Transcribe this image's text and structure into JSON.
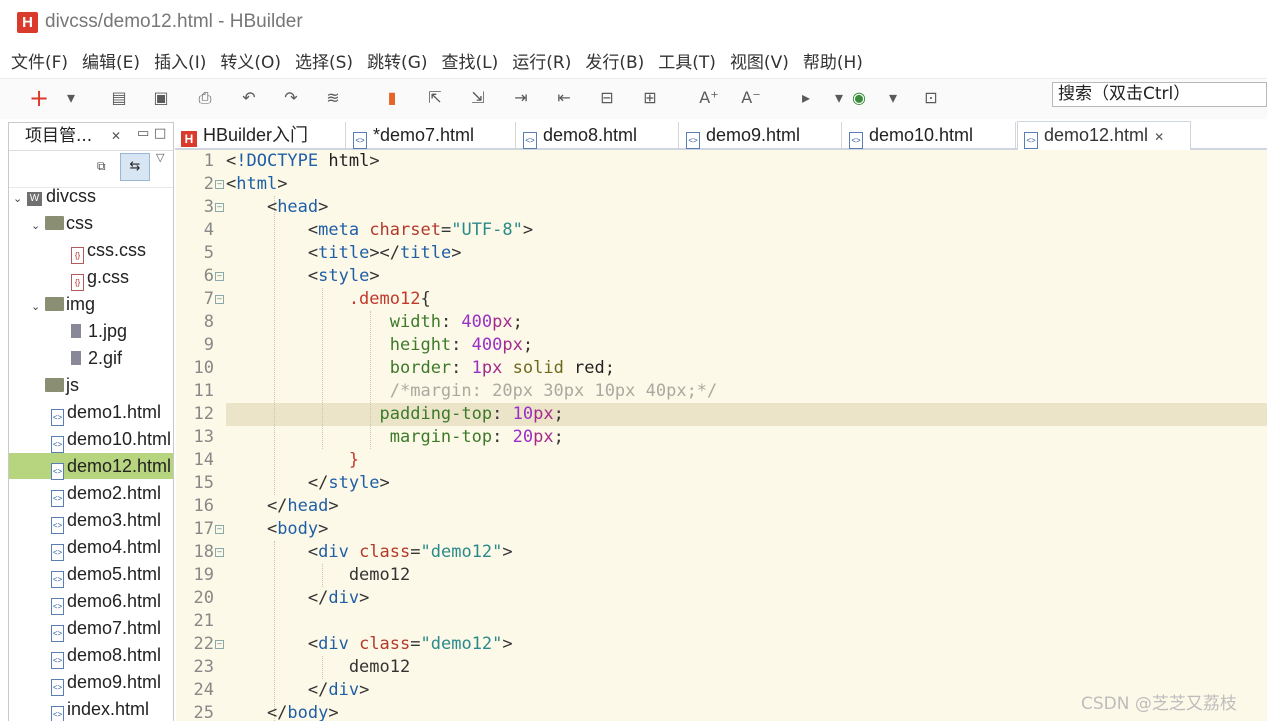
{
  "window": {
    "title": "divcss/demo12.html  -  HBuilder",
    "logo": "H"
  },
  "menu": [
    "文件(F)",
    "编辑(E)",
    "插入(I)",
    "转义(O)",
    "选择(S)",
    "跳转(G)",
    "查找(L)",
    "运行(R)",
    "发行(B)",
    "工具(T)",
    "视图(V)",
    "帮助(H)"
  ],
  "toolbar": {
    "search_placeholder": "搜索（双击Ctrl）",
    "icons": [
      "new-icon",
      "dropdown-icon",
      "save-icon",
      "save-all-icon",
      "print-icon",
      "undo-icon",
      "redo-icon",
      "format-icon",
      "bookmark-icon",
      "import-icon",
      "export-icon",
      "indent-icon",
      "outdent-icon",
      "comment-icon",
      "uncomment-icon",
      "font-increase-icon",
      "font-decrease-icon",
      "run-icon",
      "browser-chrome-icon",
      "preview-icon"
    ]
  },
  "project_panel": {
    "title": "项目管...",
    "tree": [
      {
        "label": "divcss",
        "type": "project",
        "depth": 0,
        "expanded": true
      },
      {
        "label": "css",
        "type": "folder",
        "depth": 1,
        "expanded": true
      },
      {
        "label": "css.css",
        "type": "css",
        "depth": 2
      },
      {
        "label": "g.css",
        "type": "css",
        "depth": 2
      },
      {
        "label": "img",
        "type": "folder",
        "depth": 1,
        "expanded": true
      },
      {
        "label": "1.jpg",
        "type": "file",
        "depth": 2
      },
      {
        "label": "2.gif",
        "type": "file",
        "depth": 2
      },
      {
        "label": "js",
        "type": "folder",
        "depth": 1
      },
      {
        "label": "demo1.html",
        "type": "html",
        "depth": 1
      },
      {
        "label": "demo10.html",
        "type": "html",
        "depth": 1
      },
      {
        "label": "demo12.html",
        "type": "html",
        "depth": 1,
        "selected": true
      },
      {
        "label": "demo2.html",
        "type": "html",
        "depth": 1
      },
      {
        "label": "demo3.html",
        "type": "html",
        "depth": 1
      },
      {
        "label": "demo4.html",
        "type": "html",
        "depth": 1
      },
      {
        "label": "demo5.html",
        "type": "html",
        "depth": 1
      },
      {
        "label": "demo6.html",
        "type": "html",
        "depth": 1
      },
      {
        "label": "demo7.html",
        "type": "html",
        "depth": 1
      },
      {
        "label": "demo8.html",
        "type": "html",
        "depth": 1
      },
      {
        "label": "demo9.html",
        "type": "html",
        "depth": 1
      },
      {
        "label": "index.html",
        "type": "html",
        "depth": 1
      }
    ]
  },
  "tabs": [
    {
      "label": "HBuilder入门",
      "icon": "hbuilder"
    },
    {
      "label": "*demo7.html",
      "icon": "html"
    },
    {
      "label": "demo8.html",
      "icon": "html"
    },
    {
      "label": "demo9.html",
      "icon": "html"
    },
    {
      "label": "demo10.html",
      "icon": "html"
    },
    {
      "label": "demo12.html",
      "icon": "html",
      "active": true
    }
  ],
  "editor": {
    "current_line": 12,
    "lines": [
      {
        "n": "1",
        "fold": false,
        "tokens": [
          [
            "punc",
            "<"
          ],
          [
            "tag",
            "!DOCTYPE"
          ],
          [
            "val",
            " html"
          ],
          [
            "punc",
            ">"
          ]
        ]
      },
      {
        "n": "2",
        "fold": true,
        "tokens": [
          [
            "punc",
            "<"
          ],
          [
            "tag",
            "html"
          ],
          [
            "punc",
            ">"
          ]
        ]
      },
      {
        "n": "3",
        "fold": true,
        "tokens": [
          [
            "punc",
            "    <"
          ],
          [
            "tag",
            "head"
          ],
          [
            "punc",
            ">"
          ]
        ]
      },
      {
        "n": "4",
        "fold": false,
        "tokens": [
          [
            "punc",
            "        <"
          ],
          [
            "tag",
            "meta"
          ],
          [
            "attr",
            " charset"
          ],
          [
            "punc",
            "="
          ],
          [
            "str",
            "\"UTF-8\""
          ],
          [
            "punc",
            ">"
          ]
        ]
      },
      {
        "n": "5",
        "fold": false,
        "tokens": [
          [
            "punc",
            "        <"
          ],
          [
            "tag",
            "title"
          ],
          [
            "punc",
            "></"
          ],
          [
            "tag",
            "title"
          ],
          [
            "punc",
            ">"
          ]
        ]
      },
      {
        "n": "6",
        "fold": true,
        "tokens": [
          [
            "punc",
            "        <"
          ],
          [
            "tag",
            "style"
          ],
          [
            "punc",
            ">"
          ]
        ]
      },
      {
        "n": "7",
        "fold": true,
        "tokens": [
          [
            "sel",
            "            .demo12"
          ],
          [
            "punc",
            "{"
          ]
        ]
      },
      {
        "n": "8",
        "fold": false,
        "tokens": [
          [
            "prop",
            "                width"
          ],
          [
            "punc",
            ": "
          ],
          [
            "num",
            "400"
          ],
          [
            "unit",
            "px"
          ],
          [
            "punc",
            ";"
          ]
        ]
      },
      {
        "n": "9",
        "fold": false,
        "tokens": [
          [
            "prop",
            "                height"
          ],
          [
            "punc",
            ": "
          ],
          [
            "num",
            "400"
          ],
          [
            "unit",
            "px"
          ],
          [
            "punc",
            ";"
          ]
        ]
      },
      {
        "n": "10",
        "fold": false,
        "tokens": [
          [
            "prop",
            "                border"
          ],
          [
            "punc",
            ": "
          ],
          [
            "num",
            "1"
          ],
          [
            "unit",
            "px"
          ],
          [
            "kw",
            " solid"
          ],
          [
            "val",
            " red"
          ],
          [
            "punc",
            ";"
          ]
        ]
      },
      {
        "n": "11",
        "fold": false,
        "tokens": [
          [
            "comment",
            "                /*margin: 20px 30px 10px 40px;*/"
          ]
        ]
      },
      {
        "n": "12",
        "fold": false,
        "tokens": [
          [
            "prop",
            "               padding-top"
          ],
          [
            "punc",
            ": "
          ],
          [
            "num",
            "10"
          ],
          [
            "unit",
            "px"
          ],
          [
            "punc",
            ";"
          ]
        ]
      },
      {
        "n": "13",
        "fold": false,
        "tokens": [
          [
            "prop",
            "                margin-top"
          ],
          [
            "punc",
            ": "
          ],
          [
            "num",
            "20"
          ],
          [
            "unit",
            "px"
          ],
          [
            "punc",
            ";"
          ]
        ]
      },
      {
        "n": "14",
        "fold": false,
        "tokens": [
          [
            "sel",
            "            }"
          ]
        ]
      },
      {
        "n": "15",
        "fold": false,
        "tokens": [
          [
            "punc",
            "        </"
          ],
          [
            "tag",
            "style"
          ],
          [
            "punc",
            ">"
          ]
        ]
      },
      {
        "n": "16",
        "fold": false,
        "tokens": [
          [
            "punc",
            "    </"
          ],
          [
            "tag",
            "head"
          ],
          [
            "punc",
            ">"
          ]
        ]
      },
      {
        "n": "17",
        "fold": true,
        "tokens": [
          [
            "punc",
            "    <"
          ],
          [
            "tag",
            "body"
          ],
          [
            "punc",
            ">"
          ]
        ]
      },
      {
        "n": "18",
        "fold": true,
        "tokens": [
          [
            "punc",
            "        <"
          ],
          [
            "tag",
            "div"
          ],
          [
            "attr",
            " class"
          ],
          [
            "punc",
            "="
          ],
          [
            "str",
            "\"demo12\""
          ],
          [
            "punc",
            ">"
          ]
        ]
      },
      {
        "n": "19",
        "fold": false,
        "tokens": [
          [
            "text",
            "            demo12"
          ]
        ]
      },
      {
        "n": "20",
        "fold": false,
        "tokens": [
          [
            "punc",
            "        </"
          ],
          [
            "tag",
            "div"
          ],
          [
            "punc",
            ">"
          ]
        ]
      },
      {
        "n": "21",
        "fold": false,
        "tokens": [
          [
            "text",
            ""
          ]
        ]
      },
      {
        "n": "22",
        "fold": true,
        "tokens": [
          [
            "punc",
            "        <"
          ],
          [
            "tag",
            "div"
          ],
          [
            "attr",
            " class"
          ],
          [
            "punc",
            "="
          ],
          [
            "str",
            "\"demo12\""
          ],
          [
            "punc",
            ">"
          ]
        ]
      },
      {
        "n": "23",
        "fold": false,
        "tokens": [
          [
            "text",
            "            demo12"
          ]
        ]
      },
      {
        "n": "24",
        "fold": false,
        "tokens": [
          [
            "punc",
            "        </"
          ],
          [
            "tag",
            "div"
          ],
          [
            "punc",
            ">"
          ]
        ]
      },
      {
        "n": "25",
        "fold": false,
        "tokens": [
          [
            "punc",
            "    </"
          ],
          [
            "tag",
            "body"
          ],
          [
            "punc",
            ">"
          ]
        ]
      }
    ]
  },
  "watermark": "CSDN @芝芝又荔枝",
  "colors": {
    "accent": "#d93a2b",
    "editor_bg": "#fdf9e8",
    "selection": "#b7d47f"
  }
}
